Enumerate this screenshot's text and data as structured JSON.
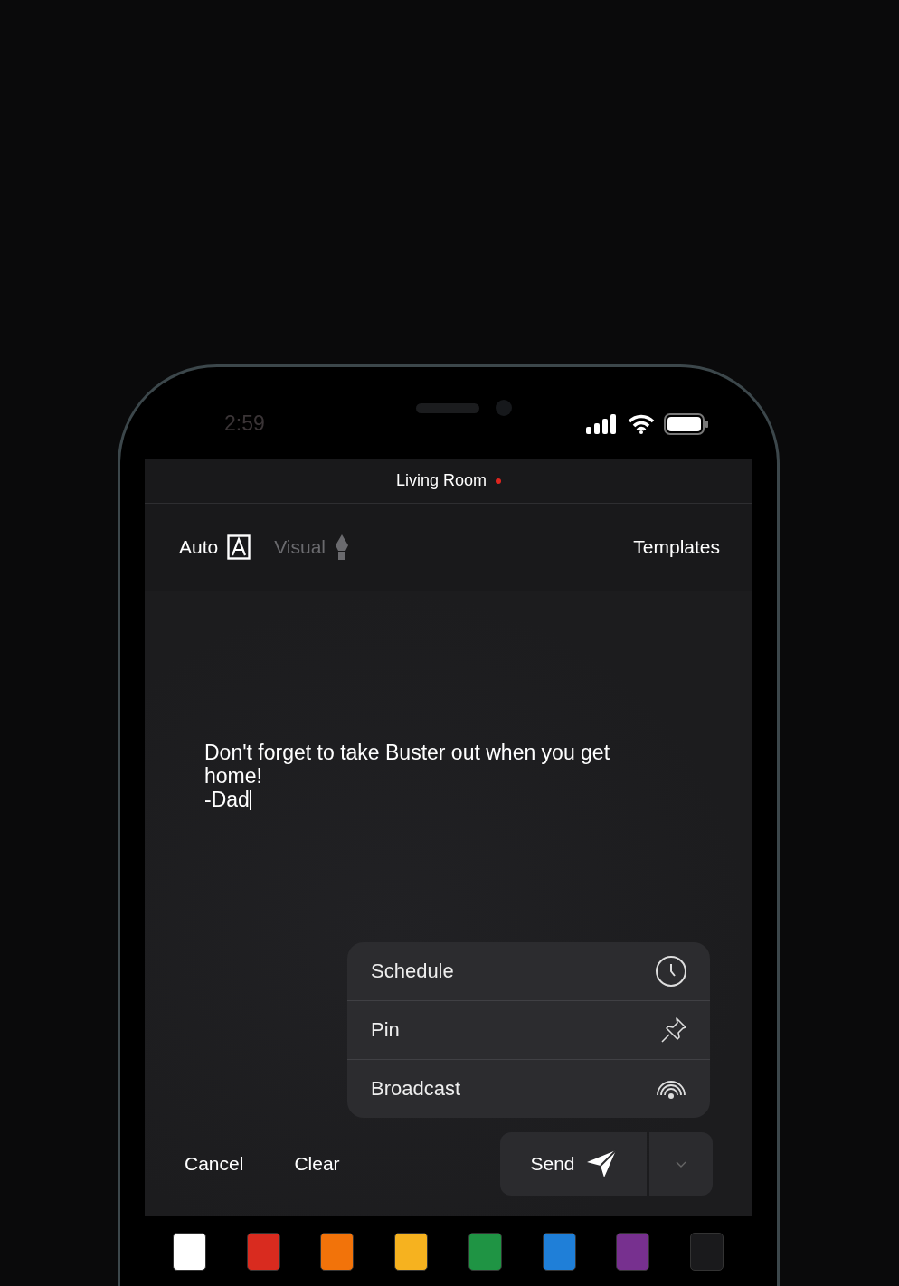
{
  "status_bar": {
    "time": "2:59"
  },
  "header": {
    "title": "Living Room",
    "status_dot": {
      "color": "#e0261f"
    }
  },
  "toolbar": {
    "modes": [
      {
        "label": "Auto",
        "kind": "auto",
        "selected": true
      },
      {
        "label": "Visual",
        "kind": "visual",
        "selected": false
      }
    ],
    "templates": "Templates"
  },
  "message": {
    "value": "Don't forget to take Buster out when you get home!\n-Dad"
  },
  "menu": {
    "items": [
      {
        "label": "Schedule",
        "kind": "clock"
      },
      {
        "label": "Pin",
        "kind": "pin"
      },
      {
        "label": "Broadcast",
        "kind": "broadcast"
      }
    ]
  },
  "actions": {
    "cancel": "Cancel",
    "clear": "Clear",
    "send": "Send"
  },
  "palette": [
    {
      "color": "#ffffff"
    },
    {
      "color": "#d92b1f"
    },
    {
      "color": "#f2730a"
    },
    {
      "color": "#f6b21f"
    },
    {
      "color": "#1f9444"
    },
    {
      "color": "#1f7fd8"
    },
    {
      "color": "#77308f"
    },
    {
      "color": "#1a1a1c"
    }
  ]
}
